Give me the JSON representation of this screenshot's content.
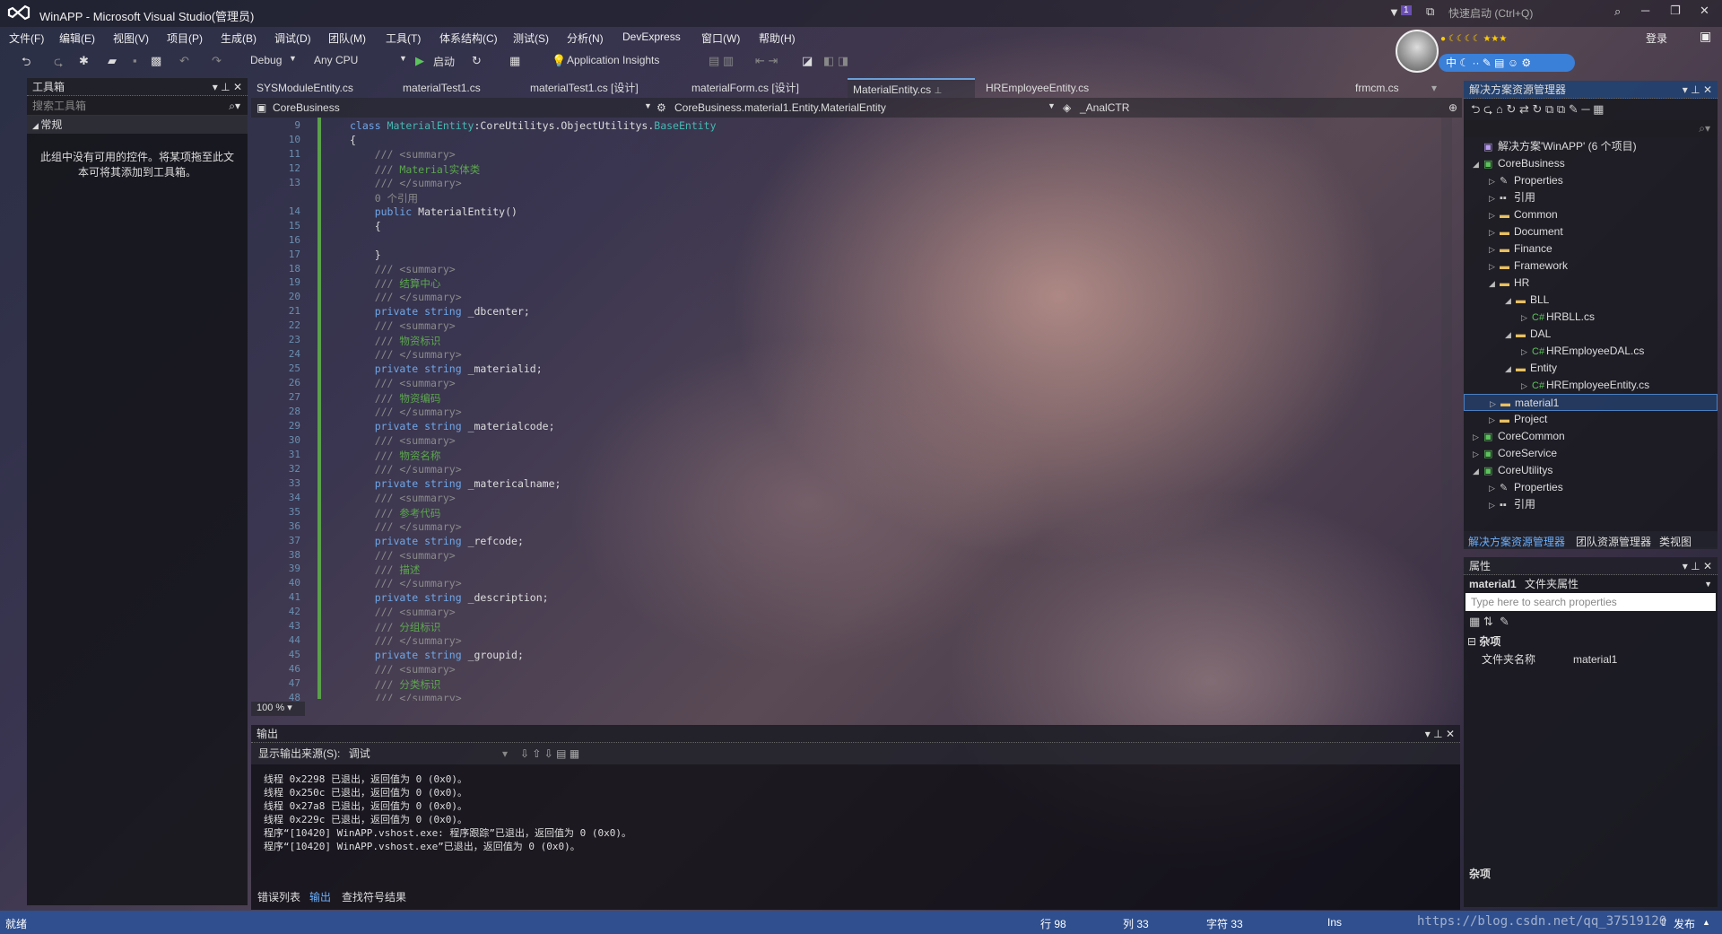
{
  "window": {
    "title": "WinAPP - Microsoft Visual Studio(管理员)",
    "quick_launch": "快速启动 (Ctrl+Q)",
    "login": "登录",
    "notify_count": "1"
  },
  "menu": [
    "文件(F)",
    "编辑(E)",
    "视图(V)",
    "项目(P)",
    "生成(B)",
    "调试(D)",
    "团队(M)",
    "工具(T)",
    "体系结构(C)",
    "测试(S)",
    "分析(N)",
    "DevExpress",
    "窗口(W)",
    "帮助(H)"
  ],
  "toolbar": {
    "config": "Debug",
    "platform": "Any CPU",
    "start": "启动",
    "insights": "Application Insights"
  },
  "ime": {
    "label": "中"
  },
  "toolbox": {
    "title": "工具箱",
    "search": "搜索工具箱",
    "group": "常规",
    "empty": "此组中没有可用的控件。将某项拖至此文本可将其添加到工具箱。"
  },
  "tabs": [
    "SYSModuleEntity.cs",
    "materialTest1.cs",
    "materialTest1.cs [设计]",
    "materialForm.cs [设计]",
    "MaterialEntity.cs",
    "HREmployeeEntity.cs",
    "frmcm.cs"
  ],
  "nav": {
    "project": "CoreBusiness",
    "type": "CoreBusiness.material1.Entity.MaterialEntity",
    "member": "_AnalCTR"
  },
  "code": {
    "line_numbers": [
      "9",
      "10",
      "11",
      "12",
      "13",
      "",
      "14",
      "15",
      "16",
      "17",
      "18",
      "19",
      "20",
      "21",
      "22",
      "23",
      "24",
      "25",
      "26",
      "27",
      "28",
      "29",
      "30",
      "31",
      "32",
      "33",
      "34",
      "35",
      "36",
      "37",
      "38",
      "39",
      "40",
      "41",
      "42",
      "43",
      "44",
      "45",
      "46",
      "47",
      "48"
    ],
    "lines": [
      [
        {
          "t": "class ",
          "c": "kw"
        },
        {
          "t": "MaterialEntity",
          "c": "ty"
        },
        {
          "t": ":CoreUtilitys.ObjectUtilitys.",
          "c": ""
        },
        {
          "t": "BaseEntity",
          "c": "ty"
        }
      ],
      [
        {
          "t": "{",
          "c": ""
        }
      ],
      [
        {
          "t": "    /// <summary>",
          "c": "cm"
        }
      ],
      [
        {
          "t": "    /// ",
          "c": "cm"
        },
        {
          "t": "Material实体类",
          "c": "cg"
        }
      ],
      [
        {
          "t": "    /// </summary>",
          "c": "cm"
        }
      ],
      [
        {
          "t": "    0 个引用",
          "c": "cm"
        }
      ],
      [
        {
          "t": "    public ",
          "c": "kw"
        },
        {
          "t": "MaterialEntity()",
          "c": ""
        }
      ],
      [
        {
          "t": "    {",
          "c": ""
        }
      ],
      [
        {
          "t": "",
          "c": ""
        }
      ],
      [
        {
          "t": "    }",
          "c": ""
        }
      ],
      [
        {
          "t": "    /// <summary>",
          "c": "cm"
        }
      ],
      [
        {
          "t": "    /// ",
          "c": "cm"
        },
        {
          "t": "结算中心",
          "c": "cg"
        }
      ],
      [
        {
          "t": "    /// </summary>",
          "c": "cm"
        }
      ],
      [
        {
          "t": "    private string ",
          "c": "kw"
        },
        {
          "t": "_dbcenter;",
          "c": ""
        }
      ],
      [
        {
          "t": "    /// <summary>",
          "c": "cm"
        }
      ],
      [
        {
          "t": "    /// ",
          "c": "cm"
        },
        {
          "t": "物资标识",
          "c": "cg"
        }
      ],
      [
        {
          "t": "    /// </summary>",
          "c": "cm"
        }
      ],
      [
        {
          "t": "    private string ",
          "c": "kw"
        },
        {
          "t": "_materialid;",
          "c": ""
        }
      ],
      [
        {
          "t": "    /// <summary>",
          "c": "cm"
        }
      ],
      [
        {
          "t": "    /// ",
          "c": "cm"
        },
        {
          "t": "物资编码",
          "c": "cg"
        }
      ],
      [
        {
          "t": "    /// </summary>",
          "c": "cm"
        }
      ],
      [
        {
          "t": "    private string ",
          "c": "kw"
        },
        {
          "t": "_materialcode;",
          "c": ""
        }
      ],
      [
        {
          "t": "    /// <summary>",
          "c": "cm"
        }
      ],
      [
        {
          "t": "    /// ",
          "c": "cm"
        },
        {
          "t": "物资名称",
          "c": "cg"
        }
      ],
      [
        {
          "t": "    /// </summary>",
          "c": "cm"
        }
      ],
      [
        {
          "t": "    private string ",
          "c": "kw"
        },
        {
          "t": "_matericalname;",
          "c": ""
        }
      ],
      [
        {
          "t": "    /// <summary>",
          "c": "cm"
        }
      ],
      [
        {
          "t": "    /// ",
          "c": "cm"
        },
        {
          "t": "参考代码",
          "c": "cg"
        }
      ],
      [
        {
          "t": "    /// </summary>",
          "c": "cm"
        }
      ],
      [
        {
          "t": "    private string ",
          "c": "kw"
        },
        {
          "t": "_refcode;",
          "c": ""
        }
      ],
      [
        {
          "t": "    /// <summary>",
          "c": "cm"
        }
      ],
      [
        {
          "t": "    /// ",
          "c": "cm"
        },
        {
          "t": "描述",
          "c": "cg"
        }
      ],
      [
        {
          "t": "    /// </summary>",
          "c": "cm"
        }
      ],
      [
        {
          "t": "    private string ",
          "c": "kw"
        },
        {
          "t": "_description;",
          "c": ""
        }
      ],
      [
        {
          "t": "    /// <summary>",
          "c": "cm"
        }
      ],
      [
        {
          "t": "    /// ",
          "c": "cm"
        },
        {
          "t": "分组标识",
          "c": "cg"
        }
      ],
      [
        {
          "t": "    /// </summary>",
          "c": "cm"
        }
      ],
      [
        {
          "t": "    private string ",
          "c": "kw"
        },
        {
          "t": "_groupid;",
          "c": ""
        }
      ],
      [
        {
          "t": "    /// <summary>",
          "c": "cm"
        }
      ],
      [
        {
          "t": "    /// ",
          "c": "cm"
        },
        {
          "t": "分类标识",
          "c": "cg"
        }
      ],
      [
        {
          "t": "    /// </summary>",
          "c": "cm"
        }
      ]
    ]
  },
  "zoom": "100 %",
  "output": {
    "title": "输出",
    "source_label": "显示输出来源(S):",
    "source_value": "调试",
    "lines": [
      "线程 0x2298 已退出，返回值为 0 (0x0)。",
      "线程 0x250c 已退出，返回值为 0 (0x0)。",
      "线程 0x27a8 已退出，返回值为 0 (0x0)。",
      "线程 0x229c 已退出，返回值为 0 (0x0)。",
      "程序“[10420] WinAPP.vshost.exe: 程序跟踪”已退出，返回值为 0 (0x0)。",
      "程序“[10420] WinAPP.vshost.exe”已退出，返回值为 0 (0x0)。"
    ]
  },
  "bottom_tabs": [
    "错误列表",
    "输出",
    "查找符号结果"
  ],
  "solution": {
    "title": "解决方案资源管理器",
    "items": [
      {
        "label": "解决方案'WinAPP' (6 个项目)",
        "level": 0,
        "arrow": "",
        "icon": "sln"
      },
      {
        "label": "CoreBusiness",
        "level": 0,
        "arrow": "open",
        "icon": "proj"
      },
      {
        "label": "Properties",
        "level": 1,
        "arrow": "closed",
        "icon": "wrench"
      },
      {
        "label": "引用",
        "level": 1,
        "arrow": "closed",
        "icon": "ref"
      },
      {
        "label": "Common",
        "level": 1,
        "arrow": "closed",
        "icon": "folder"
      },
      {
        "label": "Document",
        "level": 1,
        "arrow": "closed",
        "icon": "folder"
      },
      {
        "label": "Finance",
        "level": 1,
        "arrow": "closed",
        "icon": "folder"
      },
      {
        "label": "Framework",
        "level": 1,
        "arrow": "closed",
        "icon": "folder"
      },
      {
        "label": "HR",
        "level": 1,
        "arrow": "open",
        "icon": "folder"
      },
      {
        "label": "BLL",
        "level": 2,
        "arrow": "open",
        "icon": "folder"
      },
      {
        "label": "HRBLL.cs",
        "level": 3,
        "arrow": "closed",
        "icon": "cs"
      },
      {
        "label": "DAL",
        "level": 2,
        "arrow": "open",
        "icon": "folder"
      },
      {
        "label": "HREmployeeDAL.cs",
        "level": 3,
        "arrow": "closed",
        "icon": "cs"
      },
      {
        "label": "Entity",
        "level": 2,
        "arrow": "open",
        "icon": "folder"
      },
      {
        "label": "HREmployeeEntity.cs",
        "level": 3,
        "arrow": "closed",
        "icon": "cs"
      },
      {
        "label": "material1",
        "level": 1,
        "arrow": "closed",
        "icon": "folder",
        "selected": true
      },
      {
        "label": "Project",
        "level": 1,
        "arrow": "closed",
        "icon": "folder"
      },
      {
        "label": "CoreCommon",
        "level": 0,
        "arrow": "closed",
        "icon": "proj"
      },
      {
        "label": "CoreService",
        "level": 0,
        "arrow": "closed",
        "icon": "proj"
      },
      {
        "label": "CoreUtilitys",
        "level": 0,
        "arrow": "open",
        "icon": "proj"
      },
      {
        "label": "Properties",
        "level": 1,
        "arrow": "closed",
        "icon": "wrench"
      },
      {
        "label": "引用",
        "level": 1,
        "arrow": "closed",
        "icon": "ref"
      }
    ]
  },
  "solution_tabs": [
    "解决方案资源管理器",
    "团队资源管理器",
    "类视图"
  ],
  "properties": {
    "title": "属性",
    "object": "material1",
    "object_type": "文件夹属性",
    "search": "Type here to search properties",
    "category": "杂项",
    "prop_name": "文件夹名称",
    "prop_value": "material1",
    "desc": "杂项"
  },
  "status": {
    "ready": "就绪",
    "row": "行 98",
    "col": "列 33",
    "char": "字符 33",
    "ins": "Ins",
    "publish": "发布"
  },
  "watermark": "https://blog.csdn.net/qq_37519120"
}
